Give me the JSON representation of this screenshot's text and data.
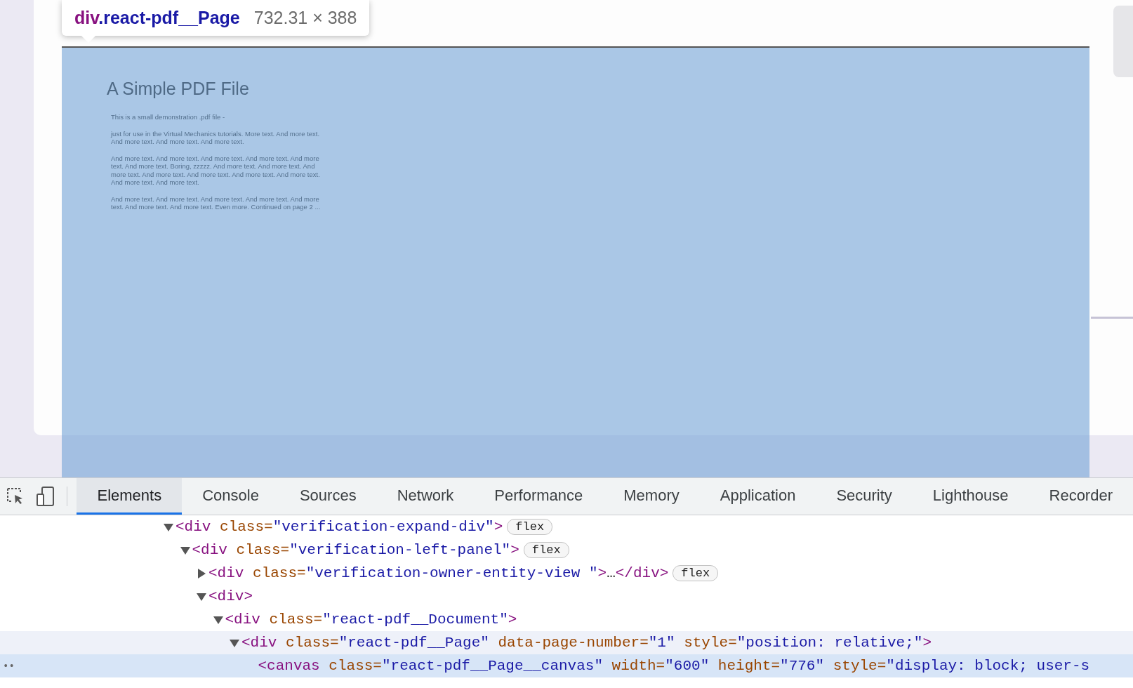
{
  "tooltip": {
    "tag": "div",
    "selector": ".react-pdf__Page",
    "size": "732.31 × 388"
  },
  "pdf_page": {
    "title": "A Simple PDF File",
    "paragraphs": [
      "This is a small demonstration .pdf file -",
      "just for use in the Virtual Mechanics tutorials. More text. And more text. And more text. And more text. And more text.",
      "And more text. And more text. And more text. And more text. And more text. And more text. Boring, zzzzz. And more text. And more text. And more text. And more text. And more text. And more text. And more text. And more text. And more text.",
      "And more text. And more text. And more text. And more text. And more text. And more text. And more text. Even more. Continued on page 2 ..."
    ]
  },
  "devtools": {
    "tabs": [
      {
        "label": "Elements",
        "selected": true
      },
      {
        "label": "Console",
        "selected": false
      },
      {
        "label": "Sources",
        "selected": false
      },
      {
        "label": "Network",
        "selected": false
      },
      {
        "label": "Performance",
        "selected": false
      },
      {
        "label": "Memory",
        "selected": false
      },
      {
        "label": "Application",
        "selected": false
      },
      {
        "label": "Security",
        "selected": false
      },
      {
        "label": "Lighthouse",
        "selected": false
      },
      {
        "label": "Recorder",
        "selected": false
      }
    ],
    "tree": [
      {
        "expanded": true,
        "selected": false,
        "hovered": false,
        "tokens": [
          {
            "kind": "tag",
            "text": "<div"
          },
          {
            "kind": "attr",
            "text": " class="
          },
          {
            "kind": "value",
            "text": "\"verification-expand-div\""
          },
          {
            "kind": "tag",
            "text": ">"
          }
        ],
        "badge": "flex",
        "children": [
          {
            "expanded": true,
            "selected": false,
            "hovered": false,
            "tokens": [
              {
                "kind": "tag",
                "text": "<div"
              },
              {
                "kind": "attr",
                "text": " class="
              },
              {
                "kind": "value",
                "text": "\"verification-left-panel\""
              },
              {
                "kind": "tag",
                "text": ">"
              }
            ],
            "badge": "flex",
            "children": [
              {
                "expanded": false,
                "selected": false,
                "hovered": false,
                "tokens": [
                  {
                    "kind": "tag",
                    "text": "<div"
                  },
                  {
                    "kind": "attr",
                    "text": " class="
                  },
                  {
                    "kind": "value",
                    "text": "\"verification-owner-entity-view \""
                  },
                  {
                    "kind": "tag",
                    "text": ">"
                  },
                  {
                    "kind": "plain",
                    "text": "…"
                  },
                  {
                    "kind": "tag",
                    "text": "</div>"
                  }
                ],
                "badge": "flex"
              },
              {
                "expanded": true,
                "selected": false,
                "hovered": false,
                "tokens": [
                  {
                    "kind": "tag",
                    "text": "<div>"
                  }
                ],
                "children": [
                  {
                    "expanded": true,
                    "selected": false,
                    "hovered": false,
                    "tokens": [
                      {
                        "kind": "tag",
                        "text": "<div"
                      },
                      {
                        "kind": "attr",
                        "text": " class="
                      },
                      {
                        "kind": "value",
                        "text": "\"react-pdf__Document\""
                      },
                      {
                        "kind": "tag",
                        "text": ">"
                      }
                    ],
                    "children": [
                      {
                        "expanded": true,
                        "selected": false,
                        "hovered": true,
                        "tokens": [
                          {
                            "kind": "tag",
                            "text": "<div"
                          },
                          {
                            "kind": "attr",
                            "text": " class="
                          },
                          {
                            "kind": "value",
                            "text": "\"react-pdf__Page\""
                          },
                          {
                            "kind": "attr",
                            "text": " data-page-number="
                          },
                          {
                            "kind": "value",
                            "text": "\"1\""
                          },
                          {
                            "kind": "attr",
                            "text": " style="
                          },
                          {
                            "kind": "value",
                            "text": "\"position: relative;\""
                          },
                          {
                            "kind": "tag",
                            "text": ">"
                          }
                        ],
                        "children": [
                          {
                            "selected": true,
                            "hovered": false,
                            "gutter": "••",
                            "tokens": [
                              {
                                "kind": "tag",
                                "text": "<canvas"
                              },
                              {
                                "kind": "attr",
                                "text": " class="
                              },
                              {
                                "kind": "value",
                                "text": "\"react-pdf__Page__canvas\""
                              },
                              {
                                "kind": "attr",
                                "text": " width="
                              },
                              {
                                "kind": "value",
                                "text": "\"600\""
                              },
                              {
                                "kind": "attr",
                                "text": " height="
                              },
                              {
                                "kind": "value",
                                "text": "\"776\""
                              },
                              {
                                "kind": "attr",
                                "text": " style="
                              },
                              {
                                "kind": "value",
                                "text": "\"display: block; user-s"
                              }
                            ]
                          }
                        ]
                      }
                    ]
                  }
                ]
              }
            ]
          }
        ]
      }
    ]
  }
}
